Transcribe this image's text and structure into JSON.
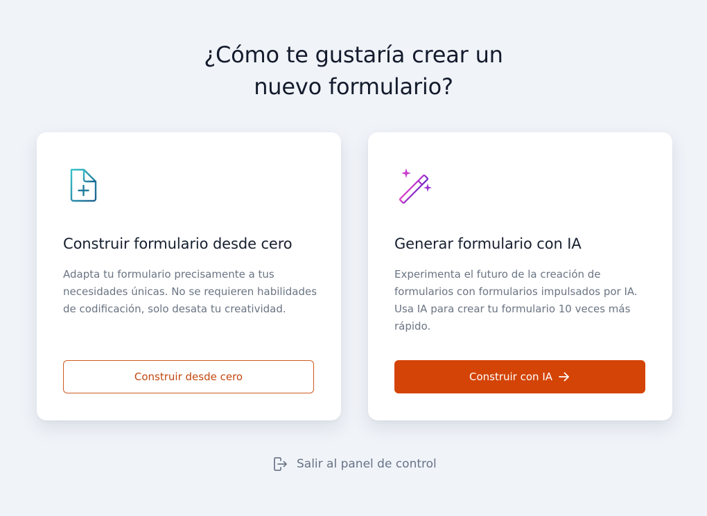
{
  "heading": {
    "line1": "¿Cómo te gustaría crear un",
    "line2": "nuevo formulario?"
  },
  "cards": [
    {
      "icon": "document-plus-icon",
      "title": "Construir formulario desde cero",
      "description": "Adapta tu formulario precisamente a tus necesidades únicas. No se requieren habilidades de codificación, solo desata tu creatividad.",
      "button_label": "Construir desde cero"
    },
    {
      "icon": "magic-wand-icon",
      "title": "Generar formulario con IA",
      "description": "Experimenta el futuro de la creación de formularios con formularios impulsados por IA. Usa IA para crear tu formulario 10 veces más rápido.",
      "button_label": "Construir con IA",
      "button_icon": "arrow-right-icon"
    }
  ],
  "exit": {
    "label": "Salir al panel de control",
    "icon": "exit-icon"
  },
  "colors": {
    "background": "#f0f3f8",
    "accent": "#d44407",
    "teal_icon": "#1a9aa6",
    "ai_icon": "#b22bd0",
    "heading_text": "#131b2c",
    "muted_text": "#6a7483"
  }
}
